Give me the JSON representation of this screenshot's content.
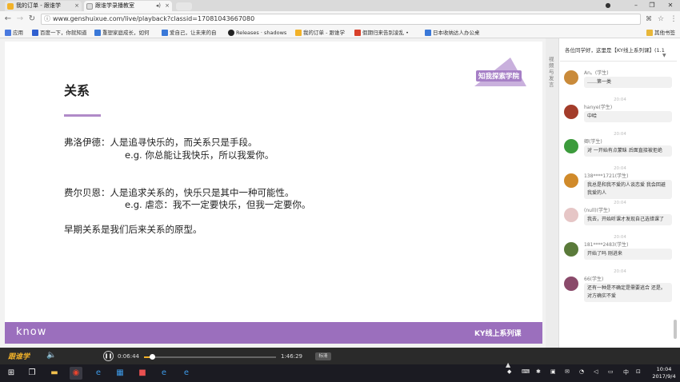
{
  "browser": {
    "tabs": [
      {
        "title": "我的订单 - 跟谁学",
        "active": false
      },
      {
        "title": "跟谁学录播教室",
        "active": true
      }
    ],
    "url": "www.genshuixue.com/live/playback?classid=17081043667080",
    "bookmarks": [
      "应用",
      "百度一下，你就知道",
      "重塑家庭成长，如何",
      "爱自己，让未来的自",
      "Releases · shadows",
      "我的订单 - 跟谁学",
      "假期归来告别凌乱 •",
      "日本收纳达人办公桌"
    ],
    "other_bookmarks": "其他书签"
  },
  "slide": {
    "title": "关系",
    "lines": [
      "弗洛伊德：人是追寻快乐的，而关系只是手段。",
      "e.g. 你总能让我快乐，所以我爱你。",
      "费尔贝恩：人是追求关系的，快乐只是其中一种可能性。",
      "e.g. 虐恋：我不一定要快乐，但我一定要你。",
      "早期关系是我们后来关系的原型。"
    ],
    "logo_text": "知我探索学院",
    "footer_brand": "know",
    "footer_course": "KY线上系列课"
  },
  "side_tab": "视频与发言",
  "chat": {
    "header": "各位同学好，这里是【KY线上系列课】(1.1",
    "messages": [
      {
        "name": "An。(学生)",
        "text": "……第一类",
        "time": "20:04",
        "avatar_color": "#c98a3a"
      },
      {
        "name": "hanye(学生)",
        "text": "中哈",
        "time": "20:04",
        "avatar_color": "#a33c2a"
      },
      {
        "name": "卿(学生)",
        "text": "对 一开始有点蒙昧 后面直接被拒绝",
        "time": "20:04",
        "avatar_color": "#3c9b3c"
      },
      {
        "name": "138****1721(学生)",
        "text": "我总是和我不爱的人谈恋爱 我会回避我爱的人",
        "time": "20:04",
        "avatar_color": "#d08a2a"
      },
      {
        "name": "(null)(学生)",
        "text": "我去，开始听课才发现自己选错课了",
        "time": "20:04",
        "avatar_color": "#e6c6c6"
      },
      {
        "name": "181****2483(学生)",
        "text": "开始了吗 刚进来",
        "time": "20:04",
        "avatar_color": "#5a7a3a"
      },
      {
        "name": "66(学生)",
        "text": "还有一种是不确定是需要逃合 还是。对方确实不爱",
        "time": "",
        "avatar_color": "#8a4a6a"
      }
    ]
  },
  "player": {
    "logo": "跟谁学",
    "current_time": "0:06:44",
    "total_time": "1:46:29",
    "progress": 0.063,
    "rate_label": "标清"
  },
  "taskbar": {
    "clock_time": "10:04",
    "clock_date": "2017/9/4",
    "ime": "中"
  }
}
